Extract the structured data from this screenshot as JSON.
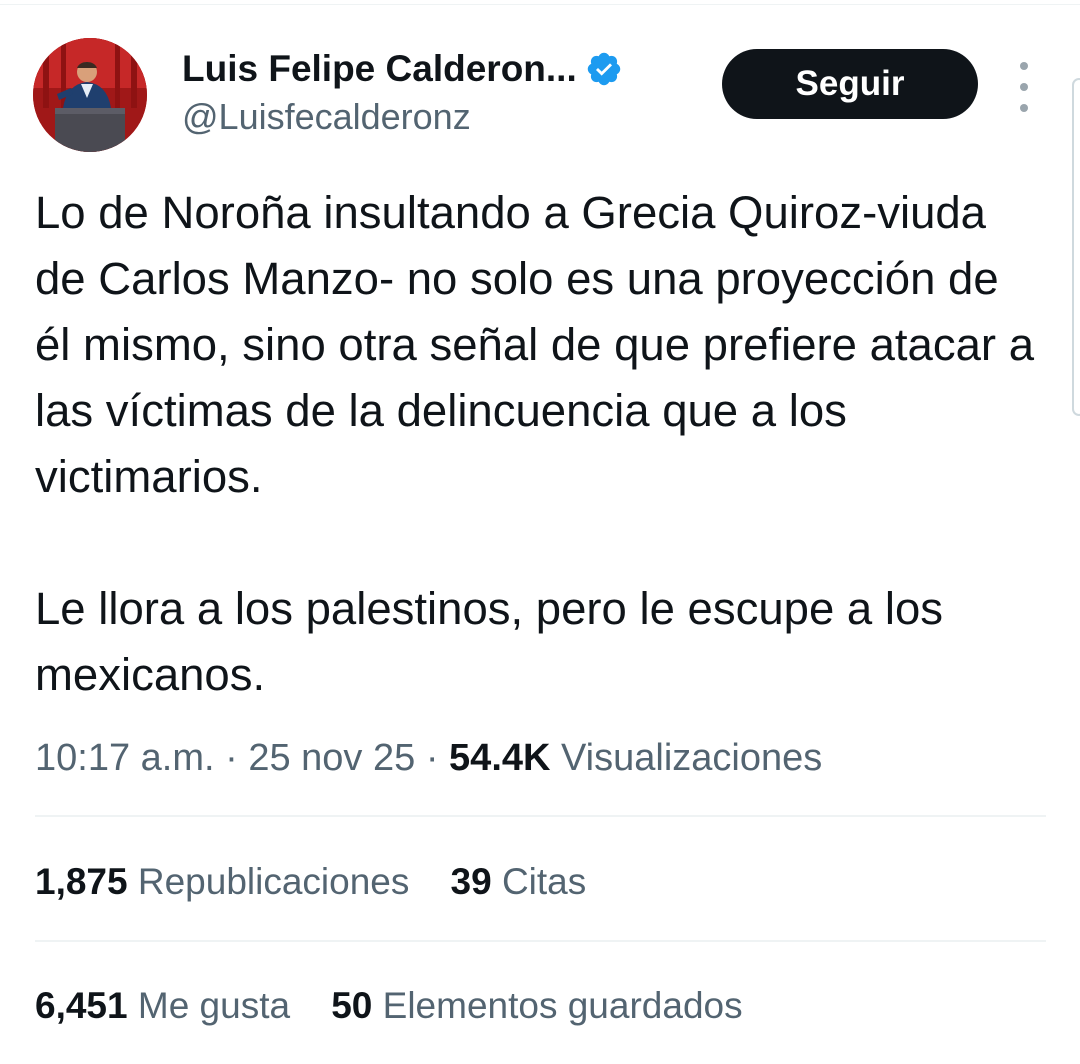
{
  "author": {
    "display_name": "Luis Felipe Calderon...",
    "handle": "@Luisfecalderonz",
    "verified_icon": "verified-badge-icon",
    "avatar_icon": "avatar-photo"
  },
  "follow_button": {
    "label": "Seguir"
  },
  "more_menu": {
    "icon": "more-vertical-icon"
  },
  "tweet": {
    "paragraph1": "Lo de Noroña insultando a Grecia Quiroz-viuda de Carlos Manzo- no solo es una proyección de él mismo, sino otra señal de que prefiere atacar a las víctimas de la delincuencia que a los victimarios.",
    "paragraph2": "Le llora a los palestinos, pero le escupe a los mexicanos."
  },
  "meta": {
    "time": "10:17 a.m.",
    "sep": "·",
    "date": "25 nov 25",
    "views_count": "54.4K",
    "views_label": "Visualizaciones"
  },
  "stats": {
    "reposts_count": "1,875",
    "reposts_label": "Republicaciones",
    "quotes_count": "39",
    "quotes_label": "Citas",
    "likes_count": "6,451",
    "likes_label": "Me gusta",
    "bookmarks_count": "50",
    "bookmarks_label": "Elementos guardados"
  },
  "colors": {
    "text_primary": "#0f1419",
    "text_secondary": "#536471",
    "verified_blue": "#1d9bf0",
    "divider": "#eff3f4"
  }
}
